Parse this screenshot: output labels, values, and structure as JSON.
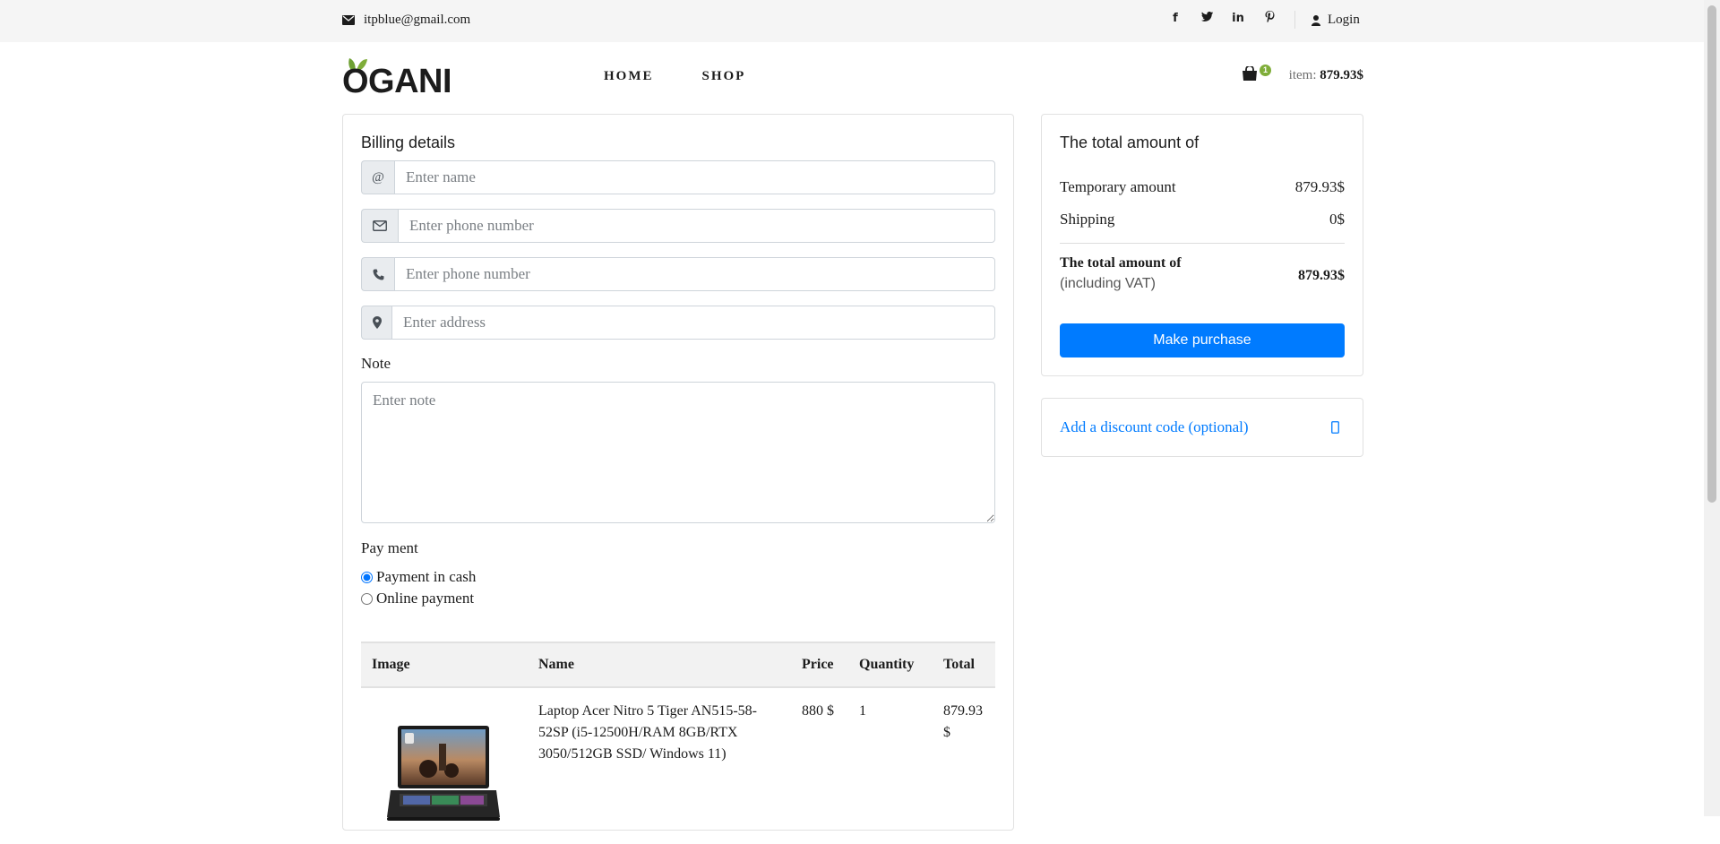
{
  "topbar": {
    "email": "itpblue@gmail.com",
    "socials": [
      "facebook-icon",
      "twitter-icon",
      "linkedin-icon",
      "pinterest-icon"
    ],
    "login": "Login"
  },
  "header": {
    "logo_text": "OGANI",
    "nav": {
      "home": "HOME",
      "shop": "SHOP"
    },
    "cart_count": "1",
    "cart_label": "item:",
    "cart_amount": "879.93$"
  },
  "billing": {
    "title": "Billing details",
    "name_prefix": "@",
    "name_placeholder": "Enter name",
    "email_placeholder": "Enter phone number",
    "phone_placeholder": "Enter phone number",
    "address_placeholder": "Enter address",
    "note_label": "Note",
    "note_placeholder": "Enter note",
    "payment_label": "Pay ment",
    "payment_options": [
      "Payment in cash",
      "Online payment"
    ],
    "payment_selected": "Payment in cash"
  },
  "order_table": {
    "headers": [
      "Image",
      "Name",
      "Price",
      "Quantity",
      "Total"
    ],
    "rows": [
      {
        "name": "Laptop Acer Nitro 5 Tiger AN515-58-52SP (i5-12500H/RAM 8GB/RTX 3050/512GB SSD/ Windows 11)",
        "price": "880 $",
        "quantity": "1",
        "total": "879.93 $"
      }
    ]
  },
  "summary": {
    "title": "The total amount of",
    "temporary_label": "Temporary amount",
    "temporary_value": "879.93$",
    "shipping_label": "Shipping",
    "shipping_value": "0$",
    "total_label": "The total amount of",
    "total_sub": "(including VAT)",
    "total_value": "879.93$",
    "purchase_button": "Make purchase"
  },
  "discount": {
    "link": "Add a discount code (optional)"
  },
  "colors": {
    "accent": "#007bff",
    "brand_green": "#7fad39",
    "topbar_bg": "#f5f5f5"
  }
}
